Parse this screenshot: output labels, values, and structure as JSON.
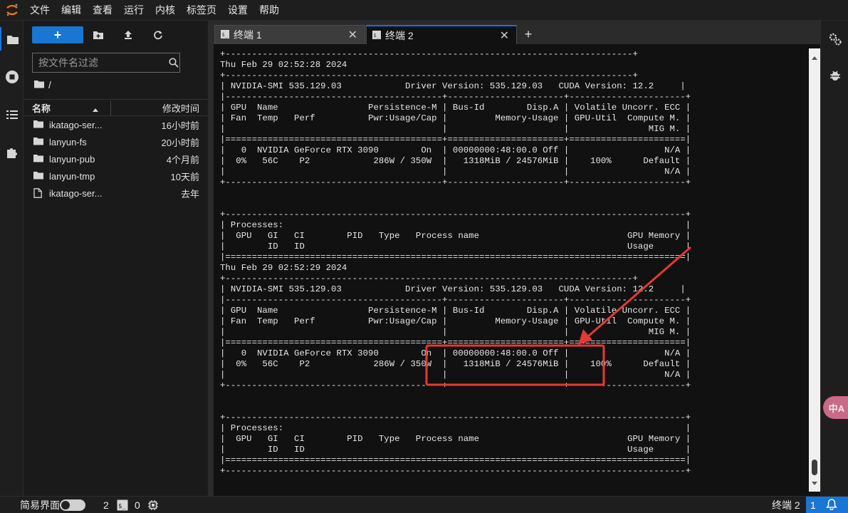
{
  "menu": [
    "文件",
    "编辑",
    "查看",
    "运行",
    "内核",
    "标签页",
    "设置",
    "帮助"
  ],
  "filebrowser": {
    "new_label": "+",
    "search_placeholder": "按文件名过滤",
    "path": "/",
    "col_name": "名称",
    "col_modified": "修改时间",
    "files": [
      {
        "name": "ikatago-ser...",
        "modified": "16小时前",
        "type": "folder"
      },
      {
        "name": "lanyun-fs",
        "modified": "20小时前",
        "type": "folder"
      },
      {
        "name": "lanyun-pub",
        "modified": "4个月前",
        "type": "folder"
      },
      {
        "name": "lanyun-tmp",
        "modified": "10天前",
        "type": "folder"
      },
      {
        "name": "ikatago-ser...",
        "modified": "去年",
        "type": "file"
      }
    ]
  },
  "tabs": [
    {
      "label": "终端 1",
      "active": false,
      "close": "✕"
    },
    {
      "label": "终端 2",
      "active": true,
      "close": "✕"
    }
  ],
  "tab_add": "+",
  "terminal": {
    "lines": [
      "+-----------------------------------------------------------------------------+",
      "Thu Feb 29 02:52:28 2024",
      "+-----------------------------------------------------------------------------+",
      "| NVIDIA-SMI 535.129.03            Driver Version: 535.129.03   CUDA Version: 12.2     |",
      "|-----------------------------------------+----------------------+----------------------+",
      "| GPU  Name                 Persistence-M | Bus-Id        Disp.A | Volatile Uncorr. ECC |",
      "| Fan  Temp   Perf          Pwr:Usage/Cap |         Memory-Usage | GPU-Util  Compute M. |",
      "|                                         |                      |               MIG M. |",
      "|=========================================+======================+======================|",
      "|   0  NVIDIA GeForce RTX 3090        On  | 00000000:48:00.0 Off |                  N/A |",
      "|  0%   56C    P2            286W / 350W  |   1318MiB / 24576MiB |    100%      Default |",
      "|                                         |                      |                  N/A |",
      "+-----------------------------------------+----------------------+----------------------+",
      "",
      "",
      "+---------------------------------------------------------------------------------------+",
      "| Processes:                                                                            |",
      "|  GPU   GI   CI        PID   Type   Process name                            GPU Memory |",
      "|        ID   ID                                                             Usage      |",
      "|=======================================================================================|",
      "Thu Feb 29 02:52:29 2024",
      "+-----------------------------------------------------------------------------+",
      "| NVIDIA-SMI 535.129.03            Driver Version: 535.129.03   CUDA Version: 12.2     |",
      "|-----------------------------------------+----------------------+----------------------+",
      "| GPU  Name                 Persistence-M | Bus-Id        Disp.A | Volatile Uncorr. ECC |",
      "| Fan  Temp   Perf          Pwr:Usage/Cap |         Memory-Usage | GPU-Util  Compute M. |",
      "|                                         |                      |               MIG M. |",
      "|=========================================+======================+======================|",
      "|   0  NVIDIA GeForce RTX 3090        On  | 00000000:48:00.0 Off |                  N/A |",
      "|  0%   56C    P2            286W / 350W  |   1318MiB / 24576MiB |    100%      Default |",
      "|                                         |                      |                  N/A |",
      "+-----------------------------------------+----------------------+----------------------+",
      "",
      "",
      "+---------------------------------------------------------------------------------------+",
      "| Processes:                                                                            |",
      "|  GPU   GI   CI        PID   Type   Process name                            GPU Memory |",
      "|        ID   ID                                                             Usage      |",
      "|=======================================================================================|",
      "+---------------------------------------------------------------------------------------+"
    ]
  },
  "translate_label": "中A",
  "statusbar": {
    "simple_mode": "简易界面",
    "kernels_count": "2",
    "terminals_count": "0",
    "active_doc": "终端 2",
    "notifications": "1"
  },
  "colors": {
    "accent": "#1976d2",
    "annotation": "#e53935"
  }
}
